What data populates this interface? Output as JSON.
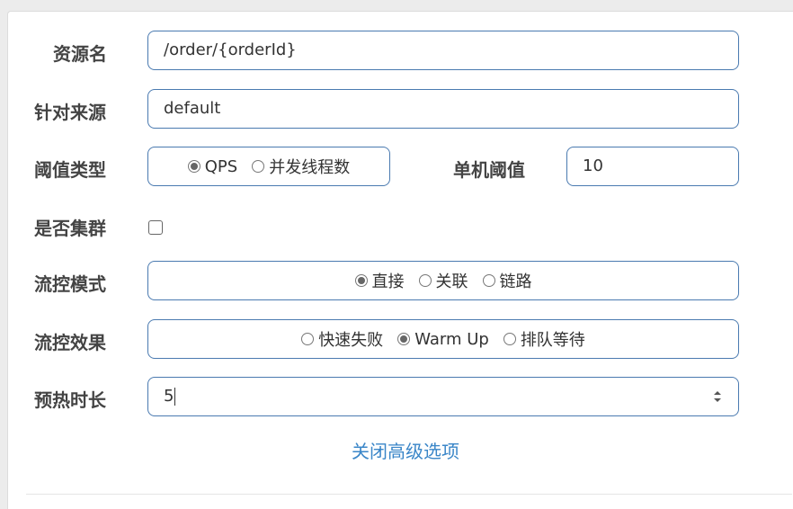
{
  "form": {
    "resource_name": {
      "label": "资源名",
      "value": "/order/{orderId}"
    },
    "limit_app": {
      "label": "针对来源",
      "value": "default"
    },
    "threshold_type": {
      "label": "阈值类型",
      "options": [
        {
          "label": "QPS",
          "checked": true
        },
        {
          "label": "并发线程数",
          "checked": false
        }
      ]
    },
    "single_threshold": {
      "label": "单机阈值",
      "value": "10"
    },
    "cluster": {
      "label": "是否集群",
      "checked": false
    },
    "flow_mode": {
      "label": "流控模式",
      "options": [
        {
          "label": "直接",
          "checked": true
        },
        {
          "label": "关联",
          "checked": false
        },
        {
          "label": "链路",
          "checked": false
        }
      ]
    },
    "flow_effect": {
      "label": "流控效果",
      "options": [
        {
          "label": "快速失败",
          "checked": false
        },
        {
          "label": "Warm Up",
          "checked": true
        },
        {
          "label": "排队等待",
          "checked": false
        }
      ]
    },
    "warmup_period": {
      "label": "预热时长",
      "value": "5",
      "icon": "spinner-updown-icon"
    },
    "advanced_toggle": {
      "label": "关闭高级选项"
    }
  },
  "colors": {
    "border": "#4a7ab0",
    "link": "#3a86c8",
    "radio_dot": "#666666"
  }
}
